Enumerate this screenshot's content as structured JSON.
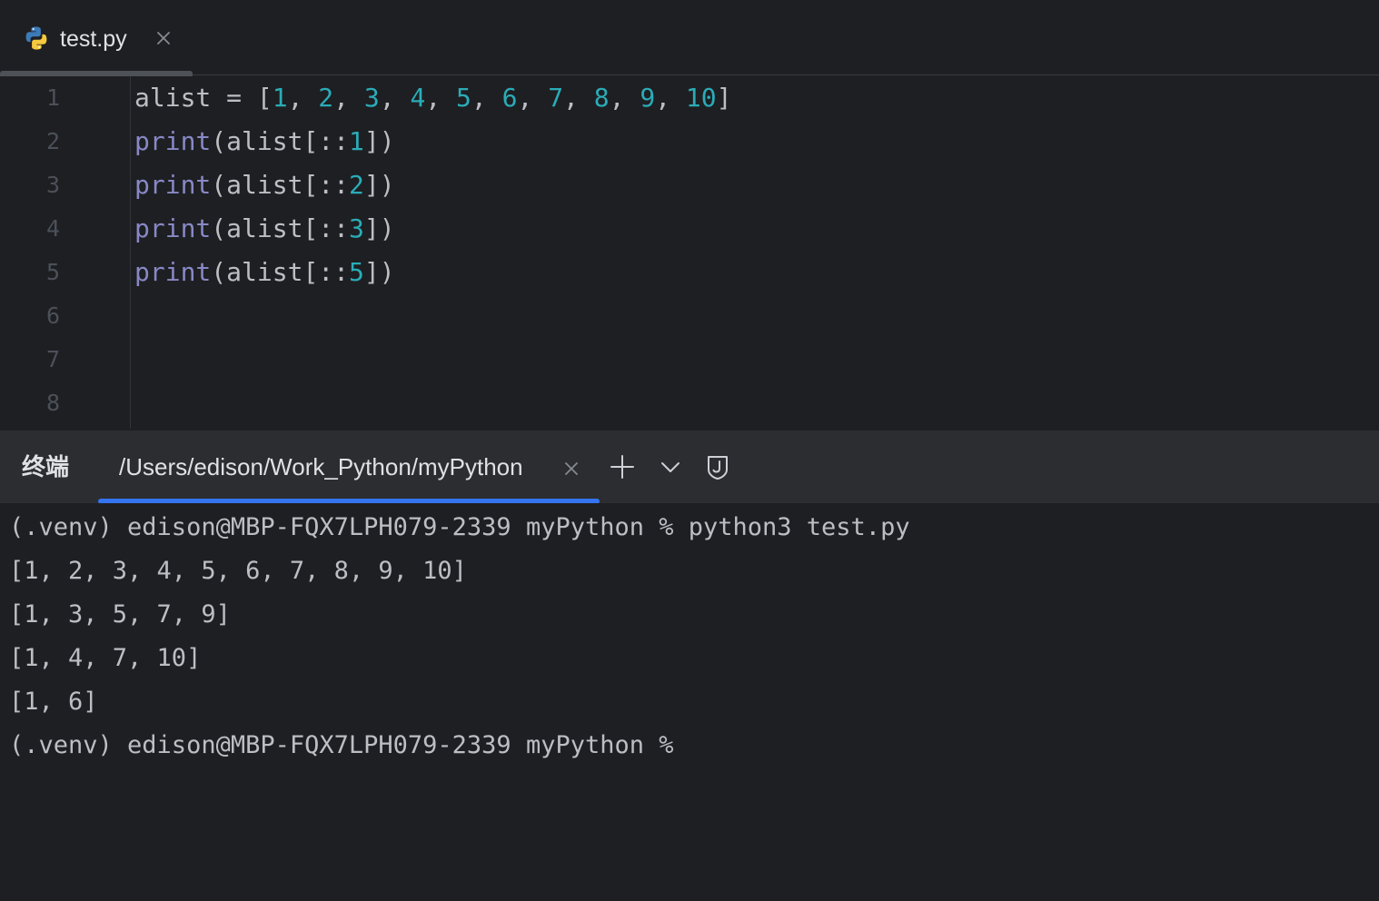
{
  "editor_tab": {
    "filename": "test.py",
    "icon": "python-icon",
    "close_icon": "close-icon"
  },
  "editor": {
    "line_numbers": [
      "1",
      "2",
      "3",
      "4",
      "5",
      "6",
      "7",
      "8"
    ],
    "code": {
      "line1": {
        "var": "alist = [",
        "n1": "1",
        "s1": ", ",
        "n2": "2",
        "s2": ", ",
        "n3": "3",
        "s3": ", ",
        "n4": "4",
        "s4": ", ",
        "n5": "5",
        "s5": ", ",
        "n6": "6",
        "s6": ", ",
        "n7": "7",
        "s7": ", ",
        "n8": "8",
        "s8": ", ",
        "n9": "9",
        "s9": ", ",
        "n10": "10",
        "end": "]"
      },
      "line2": {
        "kw": "print",
        "mid": "(alist[::",
        "num": "1",
        "end": "])"
      },
      "line3": {
        "kw": "print",
        "mid": "(alist[::",
        "num": "2",
        "end": "])"
      },
      "line4": {
        "kw": "print",
        "mid": "(alist[::",
        "num": "3",
        "end": "])"
      },
      "line5": {
        "kw": "print",
        "mid": "(alist[::",
        "num": "5",
        "end": "])"
      }
    },
    "colors": {
      "keyword": "#8888c6",
      "number": "#2aacb8",
      "text": "#bcbec4"
    }
  },
  "terminal_panel": {
    "title": "终端",
    "tab_label": "/Users/edison/Work_Python/myPython",
    "tab_close_icon": "close-icon",
    "add_icon": "plus-icon",
    "dropdown_icon": "chevron-down-icon",
    "shield_icon": "shield-icon",
    "accent": "#3574f0"
  },
  "terminal": {
    "lines": [
      "(.venv) edison@MBP-FQX7LPH079-2339 myPython % python3 test.py",
      "[1, 2, 3, 4, 5, 6, 7, 8, 9, 10]",
      "[1, 3, 5, 7, 9]",
      "[1, 4, 7, 10]",
      "[1, 6]",
      "(.venv) edison@MBP-FQX7LPH079-2339 myPython %"
    ]
  }
}
